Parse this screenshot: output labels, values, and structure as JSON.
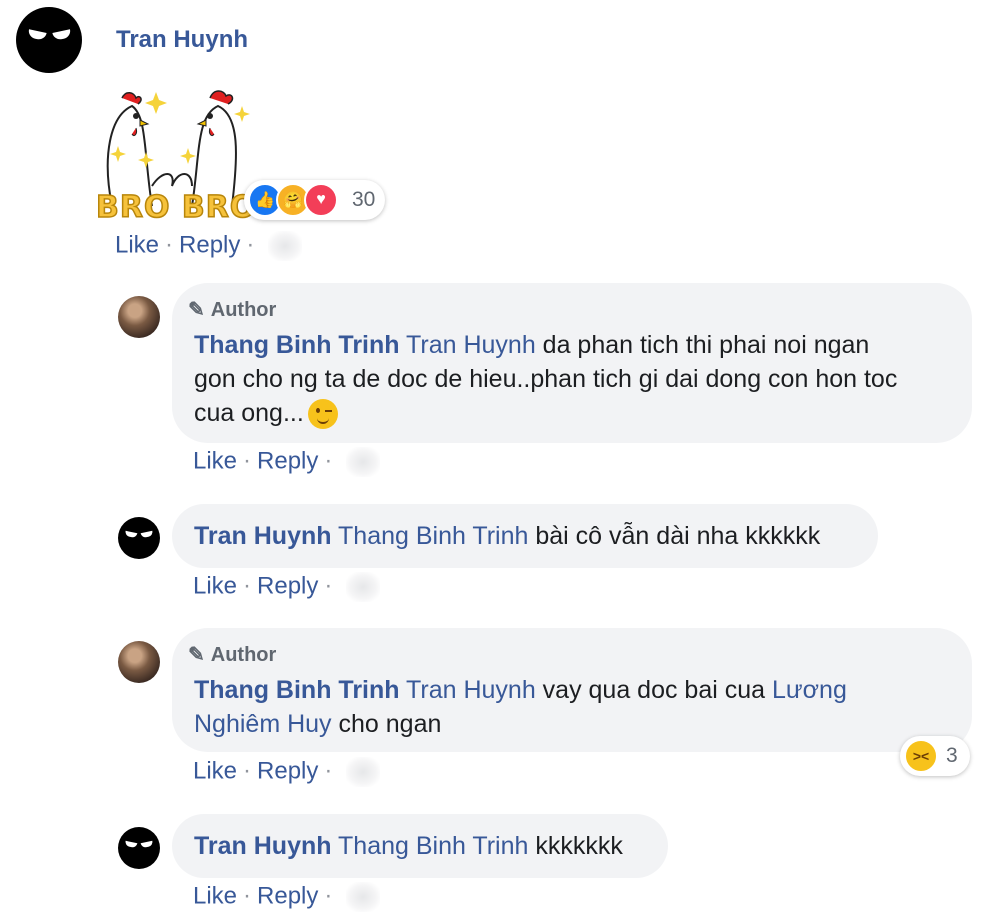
{
  "top_comment": {
    "author": "Tran Huynh",
    "sticker_text": "BRO BRO",
    "reaction_count": "30",
    "reactions": [
      "like-icon",
      "care-icon",
      "love-icon"
    ],
    "like_label": "Like",
    "reply_label": "Reply",
    "separator": "·"
  },
  "replies": [
    {
      "badge": "Author",
      "author": "Thang Binh Trinh",
      "mention": "Tran Huynh",
      "text_line1": "da phan tich thi phai noi ngan",
      "text_line2": "gon cho ng ta de doc de hieu..phan tich gi dai dong con hon toc",
      "text_line3": "cua ong...",
      "emoji": "wink-emoji",
      "like_label": "Like",
      "reply_label": "Reply",
      "separator": "·"
    },
    {
      "author": "Tran Huynh",
      "mention": "Thang Binh Trinh",
      "text": "bài cô vẫn dài nha kkkkkk",
      "like_label": "Like",
      "reply_label": "Reply",
      "separator": "·"
    },
    {
      "badge": "Author",
      "author": "Thang Binh Trinh",
      "mention": "Tran Huynh",
      "text_a": "vay qua doc bai cua",
      "mention2_line1": "Lương",
      "mention2_line2": "Nghiêm Huy",
      "text_b": "cho ngan",
      "reaction_count": "3",
      "reaction": "haha-icon",
      "like_label": "Like",
      "reply_label": "Reply",
      "separator": "·"
    },
    {
      "author": "Tran Huynh",
      "mention": "Thang Binh Trinh",
      "text": "kkkkkkk",
      "like_label": "Like",
      "reply_label": "Reply",
      "separator": "·"
    }
  ],
  "colors": {
    "link": "#385898",
    "bubble": "#f2f3f5",
    "meta": "#606770"
  }
}
